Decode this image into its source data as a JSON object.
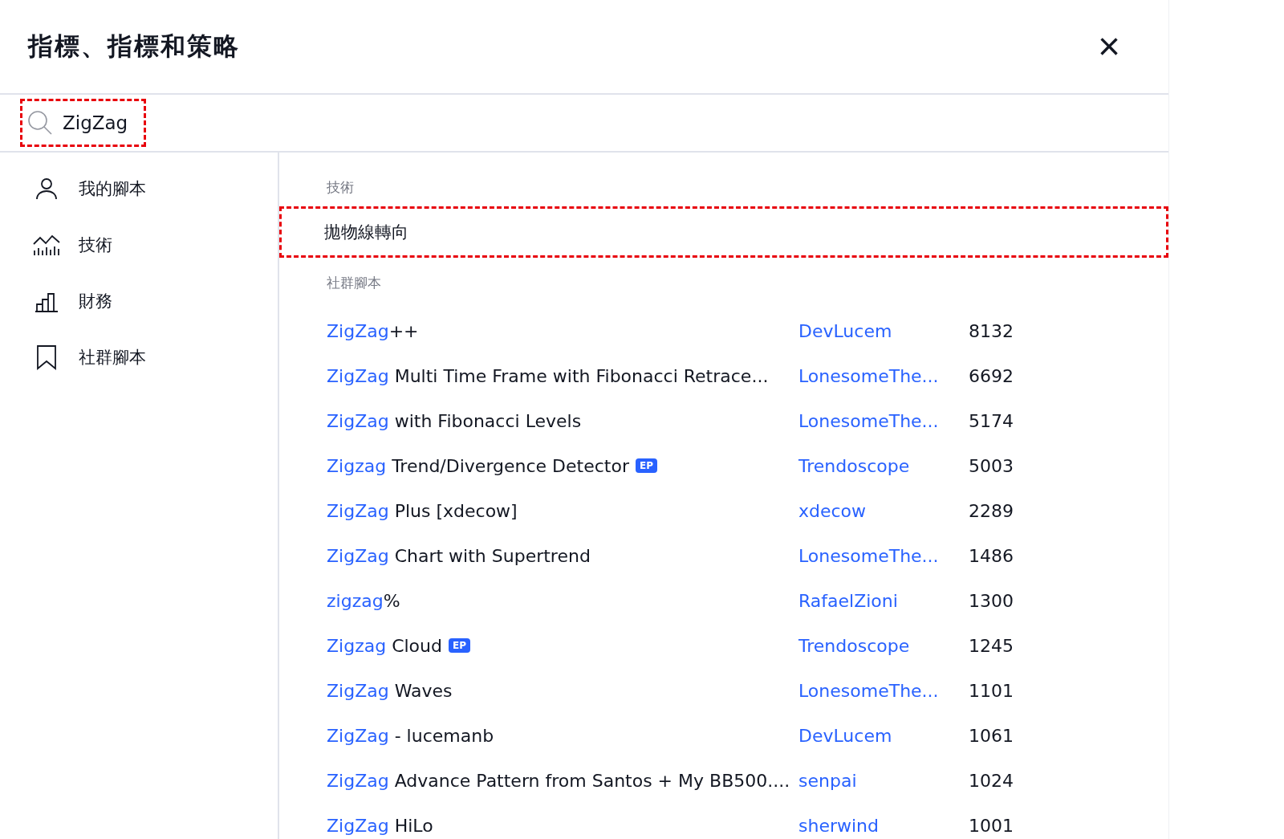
{
  "dialog": {
    "title": "指標、指標和策略",
    "close": "×"
  },
  "search": {
    "value": "ZigZag",
    "highlighted": true
  },
  "sidebar": {
    "items": [
      {
        "label": "我的腳本",
        "selected": false
      },
      {
        "label": "技術",
        "selected": false
      },
      {
        "label": "財務",
        "selected": false
      },
      {
        "label": "社群腳本",
        "selected": false
      }
    ]
  },
  "sections": [
    {
      "heading": "技術",
      "kind": "builtin",
      "items": [
        {
          "name": "拋物線轉向",
          "highlighted": true
        }
      ]
    },
    {
      "heading": "社群腳本",
      "kind": "community",
      "items": [
        {
          "match": "ZigZag",
          "rest": "++",
          "author": "DevLucem",
          "count": "8132"
        },
        {
          "match": "ZigZag",
          "rest": " Multi Time Frame with Fibonacci Retrace...",
          "author": "LonesomeThe...",
          "count": "6692"
        },
        {
          "match": "ZigZag",
          "rest": " with Fibonacci Levels",
          "author": "LonesomeThe...",
          "count": "5174"
        },
        {
          "match": "Zigzag",
          "rest": " Trend/Divergence Detector",
          "badge": "EP",
          "author": "Trendoscope",
          "count": "5003"
        },
        {
          "match": "ZigZag",
          "rest": " Plus [xdecow]",
          "author": "xdecow",
          "count": "2289"
        },
        {
          "match": "ZigZag",
          "rest": " Chart with Supertrend",
          "author": "LonesomeThe...",
          "count": "1486"
        },
        {
          "match": "zigzag",
          "rest": "%",
          "author": "RafaelZioni",
          "count": "1300"
        },
        {
          "match": "Zigzag",
          "rest": " Cloud",
          "badge": "EP",
          "author": "Trendoscope",
          "count": "1245"
        },
        {
          "match": "ZigZag",
          "rest": " Waves",
          "author": "LonesomeThe...",
          "count": "1101"
        },
        {
          "match": "ZigZag",
          "rest": " - lucemanb",
          "author": "DevLucem",
          "count": "1061"
        },
        {
          "match": "ZigZag",
          "rest": " Advance Pattern from Santos + My BB500....",
          "author": "senpai",
          "count": "1024"
        },
        {
          "match": "ZigZag",
          "rest": " HiLo",
          "author": "sherwind",
          "count": "1001"
        }
      ]
    }
  ]
}
